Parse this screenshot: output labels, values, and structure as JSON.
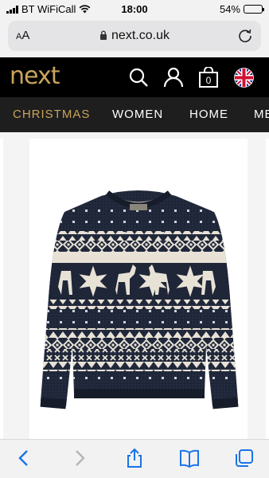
{
  "status_bar": {
    "carrier": "BT WiFiCall",
    "time": "18:00",
    "battery": "54%",
    "battery_level": 0.54
  },
  "browser": {
    "text_size_label": "AA",
    "url": "next.co.uk"
  },
  "site": {
    "logo": "next",
    "brand_color": "#c9a45c",
    "header_icons": [
      "search-icon",
      "account-icon",
      "bag-icon",
      "uk-flag-icon"
    ],
    "bag_count": "0"
  },
  "nav": {
    "items": [
      {
        "label": "CHRISTMAS",
        "active": true
      },
      {
        "label": "WOMEN",
        "active": false
      },
      {
        "label": "HOME",
        "active": false
      },
      {
        "label": "ME",
        "active": false
      }
    ]
  },
  "product": {
    "image": "navy-fair-isle-christmas-jumper"
  },
  "toolbar": {
    "icons": [
      "back-icon",
      "forward-icon",
      "share-icon",
      "bookmarks-icon",
      "tabs-icon"
    ]
  }
}
